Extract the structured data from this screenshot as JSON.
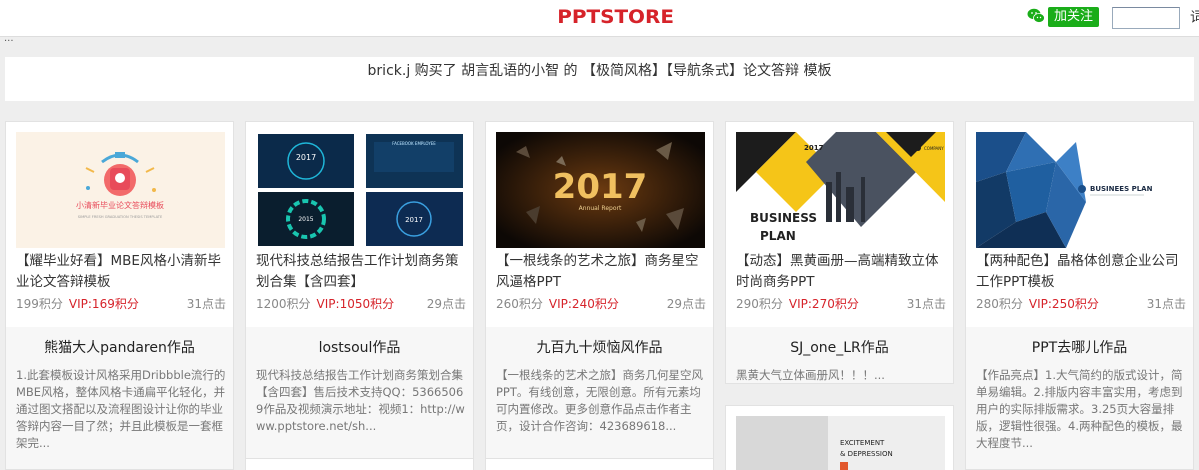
{
  "header": {
    "logo": "PPTSTORE",
    "follow_label": "加关注",
    "search_cut": "词"
  },
  "breadcrumb": "...",
  "notice": "brick.j 购买了 胡言乱语的小智 的 【极简风格】【导航条式】论文答辩 模板",
  "cards": [
    {
      "title": "【耀毕业好看】MBE风格小清新毕业论文答辩模板",
      "points": "199积分",
      "vip": "VIP:169积分",
      "clicks": "31点击",
      "author": "熊猫大人pandaren作品",
      "desc": "1.此套模板设计风格采用Dribbble流行的MBE风格，整体风格卡通扁平化轻化，并通过图文搭配以及流程图设计让你的毕业答辩内容一目了然；并且此模板是一套框架完...",
      "thumb_text": "小清新毕业论文答辩模板",
      "thumb_sub": "SIMPLE FRESH GRADUATION THESIS TEMPLATE"
    },
    {
      "title": "现代科技总结报告工作计划商务策划合集【含四套】",
      "points": "1200积分",
      "vip": "VIP:1050积分",
      "clicks": "29点击",
      "author": "lostsoul作品",
      "desc": "现代科技总结报告工作计划商务策划合集【含四套】售后技术支持QQ：53665069作品及视频演示地址：视频1：http://www.pptstore.net/sh...",
      "thumb_year": "2017",
      "thumb_year2": "2015",
      "thumb_year3": "2017",
      "thumb_label": "FACEBOOK EMPLOYEE"
    },
    {
      "title": "【一根线条的艺术之旅】商务星空风逼格PPT",
      "points": "260积分",
      "vip": "VIP:240积分",
      "clicks": "29点击",
      "author": "九百九十烦恼风作品",
      "desc": "【一根线条的艺术之旅】商务几何星空风PPT。有线创意，无限创意。所有元素均可内置修改。更多创意作品点击作者主页，设计合作咨询：423689618...",
      "thumb_year": "2017",
      "thumb_sub": "Annual Report"
    },
    {
      "title": "【动态】黑黄画册—高端精致立体时尚商务PPT",
      "points": "290积分",
      "vip": "VIP:270积分",
      "clicks": "31点击",
      "author": "SJ_one_LR作品",
      "desc": "黑黄大气立体画册风！！！...",
      "thumb_year": "2017",
      "thumb_company": "COMPANY",
      "thumb_line1": "BUSINESS",
      "thumb_line2": "PLAN"
    },
    {
      "title": "【两种配色】晶格体创意企业公司工作PPT模板",
      "points": "280积分",
      "vip": "VIP:250积分",
      "clicks": "31点击",
      "author": "PPT去哪儿作品",
      "desc": "【作品亮点】1.大气简约的版式设计，简单易编辑。2.排版内容丰富实用，考虑到用户的实际排版需求。3.25页大容量排版，逻辑性很强。4.两种配色的模板，最大程度节...",
      "thumb_text": "BUSINEES PLAN"
    }
  ],
  "next_card": {
    "line1": "EXCITEMENT",
    "line2": "& DEPRESSION"
  },
  "colors": {
    "brand": "#d6232a",
    "wechat_green": "#1aad19",
    "vip_red": "#d6232a"
  }
}
